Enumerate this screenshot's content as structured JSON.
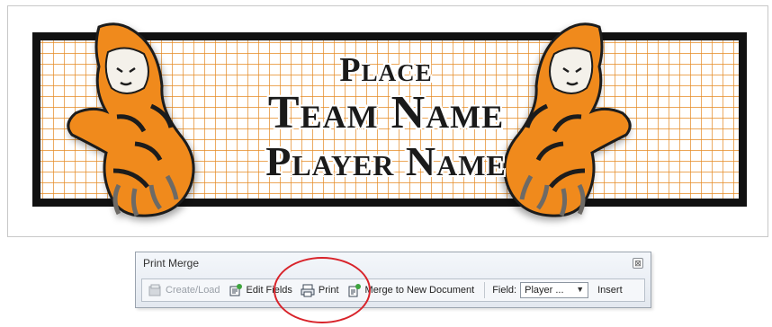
{
  "banner": {
    "place": "Place",
    "team_name": "Team Name",
    "player_name": "Player Name",
    "left_art": "tiger-mascot",
    "right_art": "tiger-mascot",
    "grid_color": "#e58a22",
    "border_color": "#111111"
  },
  "print_merge": {
    "title": "Print Merge",
    "close_icon": "close-icon",
    "buttons": {
      "create_load": "Create/Load",
      "edit_fields": "Edit Fields",
      "print": "Print",
      "merge_new_doc": "Merge to New Document"
    },
    "field_label": "Field:",
    "field_value": "Player ...",
    "insert": "Insert"
  },
  "annotation": {
    "color": "#d8232a",
    "shape": "circle"
  }
}
